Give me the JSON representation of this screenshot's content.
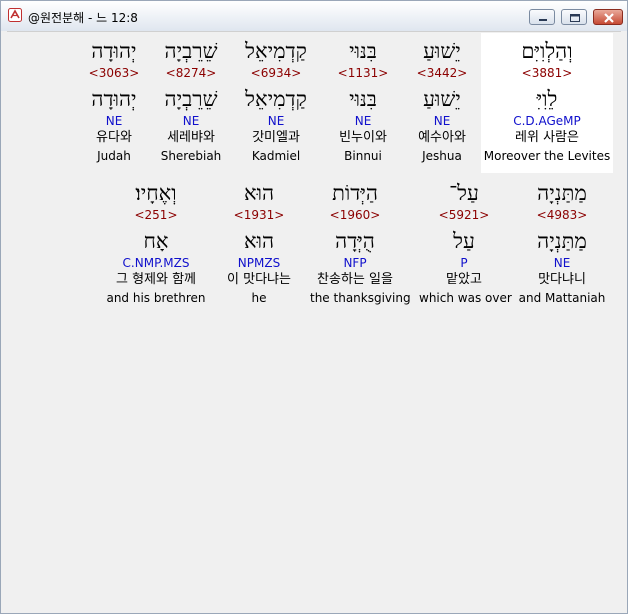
{
  "window": {
    "title": "@원전분해 - 느 12:8",
    "colors": {
      "strong": "#8b0000",
      "morph": "#1010cc",
      "highlight": "#ffffff"
    }
  },
  "rows": [
    {
      "words": [
        {
          "heb": "וְהַלְוִיִּם",
          "strong": "<3881>",
          "root": "לֵוִיִּ",
          "morph": "C.D.AGeMP",
          "kor": "레위 사람은",
          "eng": "Moreover the Levites"
        },
        {
          "heb": "יֵשׁוּעַ",
          "strong": "<3442>",
          "root": "יֵשׁוּעַ",
          "morph": "NE",
          "kor": "예수아와",
          "eng": "Jeshua"
        },
        {
          "heb": "בִּנּוּי",
          "strong": "<1131>",
          "root": "בִּנּוּי",
          "morph": "NE",
          "kor": "빈누이와",
          "eng": "Binnui"
        },
        {
          "heb": "קַדְמִיאֵל",
          "strong": "<6934>",
          "root": "קַדְמִיאֵל",
          "morph": "NE",
          "kor": "갓미엘과",
          "eng": "Kadmiel"
        },
        {
          "heb": "שֵׁרֵבְיָה",
          "strong": "<8274>",
          "root": "שֵׁרֵבְיָה",
          "morph": "NE",
          "kor": "세레뱌와",
          "eng": "Sherebiah"
        },
        {
          "heb": "יְהוּדָה",
          "strong": "<3063>",
          "root": "יְהוּדָה",
          "morph": "NE",
          "kor": "유다와",
          "eng": "Judah"
        }
      ]
    },
    {
      "words": [
        {
          "heb": "מַתַּנְיָה",
          "strong": "<4983>",
          "root": "מַתַּנְיָה",
          "morph": "NE",
          "kor": "맛다냐니",
          "eng": "and Mattaniah"
        },
        {
          "heb": "עַל־",
          "strong": "<5921>",
          "root": "עַל",
          "morph": "P",
          "kor": "맡았고",
          "eng": "which was over"
        },
        {
          "heb": "הַיְּדוֹת",
          "strong": "<1960>",
          "root": "הֻיְּדָה",
          "morph": "NFP",
          "kor": "찬송하는 일을",
          "eng": "the thanksgiving"
        },
        {
          "heb": "הוּא",
          "strong": "<1931>",
          "root": "הוּא",
          "morph": "NPMZS",
          "kor": "이 맛다냐는",
          "eng": "he"
        },
        {
          "heb": "וְאֶחָיו׃",
          "strong": "<251>",
          "root": "אָח",
          "morph": "C.NMP.MZS",
          "kor": "그 형제와 함께",
          "eng": "and his brethren"
        }
      ]
    }
  ]
}
